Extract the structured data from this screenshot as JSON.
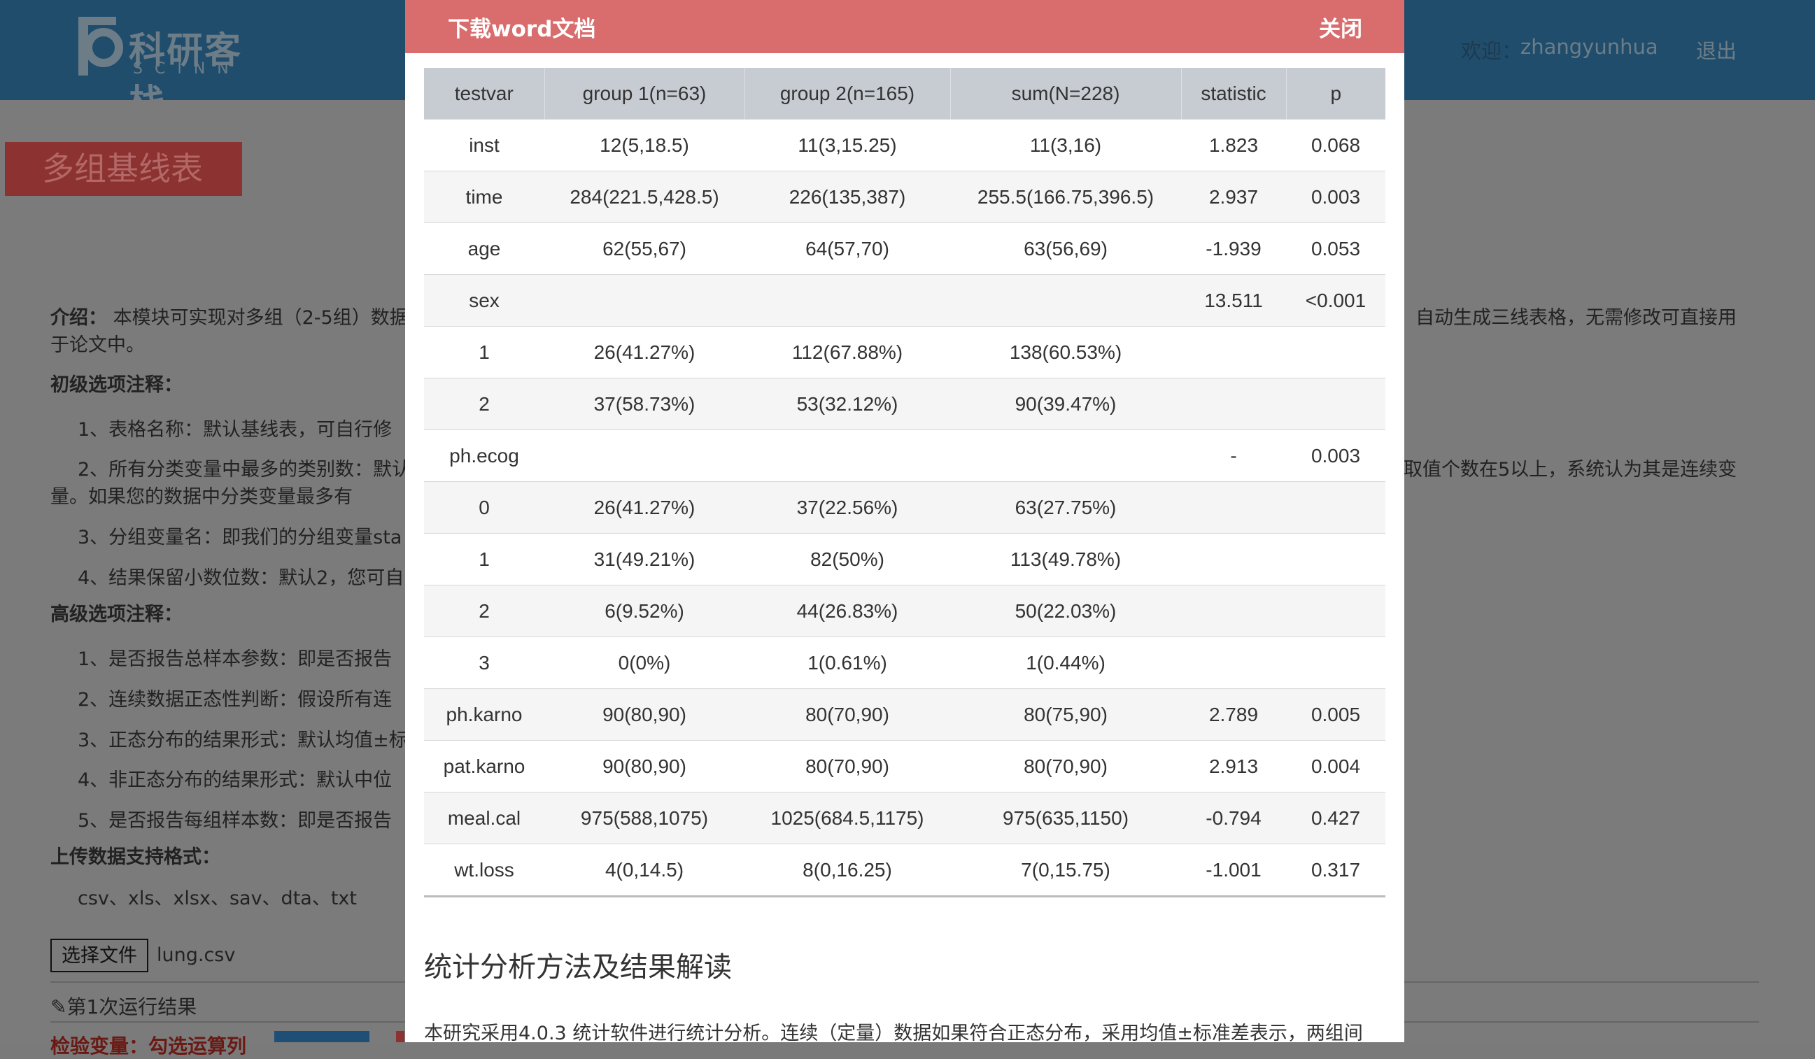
{
  "header": {
    "logo_cn": "科研客栈",
    "logo_en": "SCINN",
    "welcome_label": "欢迎：",
    "username": "zhangyunhua",
    "logout": "退出"
  },
  "page": {
    "title": "多组基线表",
    "intro_label": "介绍：",
    "intro_text": "本模块可实现对多组（2-5组）数据",
    "intro_tail": "自动生成三线表格，无需修改可直接用",
    "intro_line2": "于论文中。",
    "basic_heading": "初级选项注释：",
    "basic_items": [
      "1、表格名称：默认基线表，可自行修",
      "2、所有分类变量中最多的类别数：默认",
      "3、分组变量名：即我们的分组变量sta",
      "4、结果保留小数位数：默认2，您可自"
    ],
    "basic_item2_tail": "取值个数在5以上，系统认为其是连续变",
    "basic_item2_line2": "量。如果您的数据中分类变量最多有",
    "advanced_heading": "高级选项注释：",
    "advanced_items": [
      "1、是否报告总样本参数：即是否报告",
      "2、连续数据正态性判断：假设所有连",
      "3、正态分布的结果形式：默认均值±标",
      "4、非正态分布的结果形式：默认中位",
      "5、是否报告每组样本数：即是否报告"
    ],
    "upload_heading": "上传数据支持格式：",
    "formats": "csv、xls、xlsx、sav、dta、txt",
    "choose_file": "选择文件",
    "file_name": "lung.csv",
    "run_result": "第1次运行结果",
    "test_vars_label": "检验变量：勾选运算列"
  },
  "modal": {
    "title": "下载word文档",
    "close": "关闭",
    "table": {
      "headers": [
        "testvar",
        "group 1(n=63)",
        "group 2(n=165)",
        "sum(N=228)",
        "statistic",
        "p"
      ],
      "rows": [
        [
          "inst",
          "12(5,18.5)",
          "11(3,15.25)",
          "11(3,16)",
          "1.823",
          "0.068"
        ],
        [
          "time",
          "284(221.5,428.5)",
          "226(135,387)",
          "255.5(166.75,396.5)",
          "2.937",
          "0.003"
        ],
        [
          "age",
          "62(55,67)",
          "64(57,70)",
          "63(56,69)",
          "-1.939",
          "0.053"
        ],
        [
          "sex",
          "",
          "",
          "",
          "13.511",
          "<0.001"
        ],
        [
          "1",
          "26(41.27%)",
          "112(67.88%)",
          "138(60.53%)",
          "",
          ""
        ],
        [
          "2",
          "37(58.73%)",
          "53(32.12%)",
          "90(39.47%)",
          "",
          ""
        ],
        [
          "ph.ecog",
          "",
          "",
          "",
          "-",
          "0.003"
        ],
        [
          "0",
          "26(41.27%)",
          "37(22.56%)",
          "63(27.75%)",
          "",
          ""
        ],
        [
          "1",
          "31(49.21%)",
          "82(50%)",
          "113(49.78%)",
          "",
          ""
        ],
        [
          "2",
          "6(9.52%)",
          "44(26.83%)",
          "50(22.03%)",
          "",
          ""
        ],
        [
          "3",
          "0(0%)",
          "1(0.61%)",
          "1(0.44%)",
          "",
          ""
        ],
        [
          "ph.karno",
          "90(80,90)",
          "80(70,90)",
          "80(75,90)",
          "2.789",
          "0.005"
        ],
        [
          "pat.karno",
          "90(80,90)",
          "80(70,90)",
          "80(70,90)",
          "2.913",
          "0.004"
        ],
        [
          "meal.cal",
          "975(588,1075)",
          "1025(684.5,1175)",
          "975(635,1150)",
          "-0.794",
          "0.427"
        ],
        [
          "wt.loss",
          "4(0,14.5)",
          "8(0,16.25)",
          "7(0,15.75)",
          "-1.001",
          "0.317"
        ]
      ]
    },
    "section_title": "统计分析方法及结果解读",
    "section_body": "本研究采用4.0.3 统计软件进行统计分析。连续（定量）数据如果符合正态分布，采用均值±标准差表示，两组间"
  },
  "colors": {
    "topbar": "#204d6b",
    "modal_header": "#d96c6c",
    "table_header": "#c7ccd3",
    "title_badge": "#8c3230"
  }
}
